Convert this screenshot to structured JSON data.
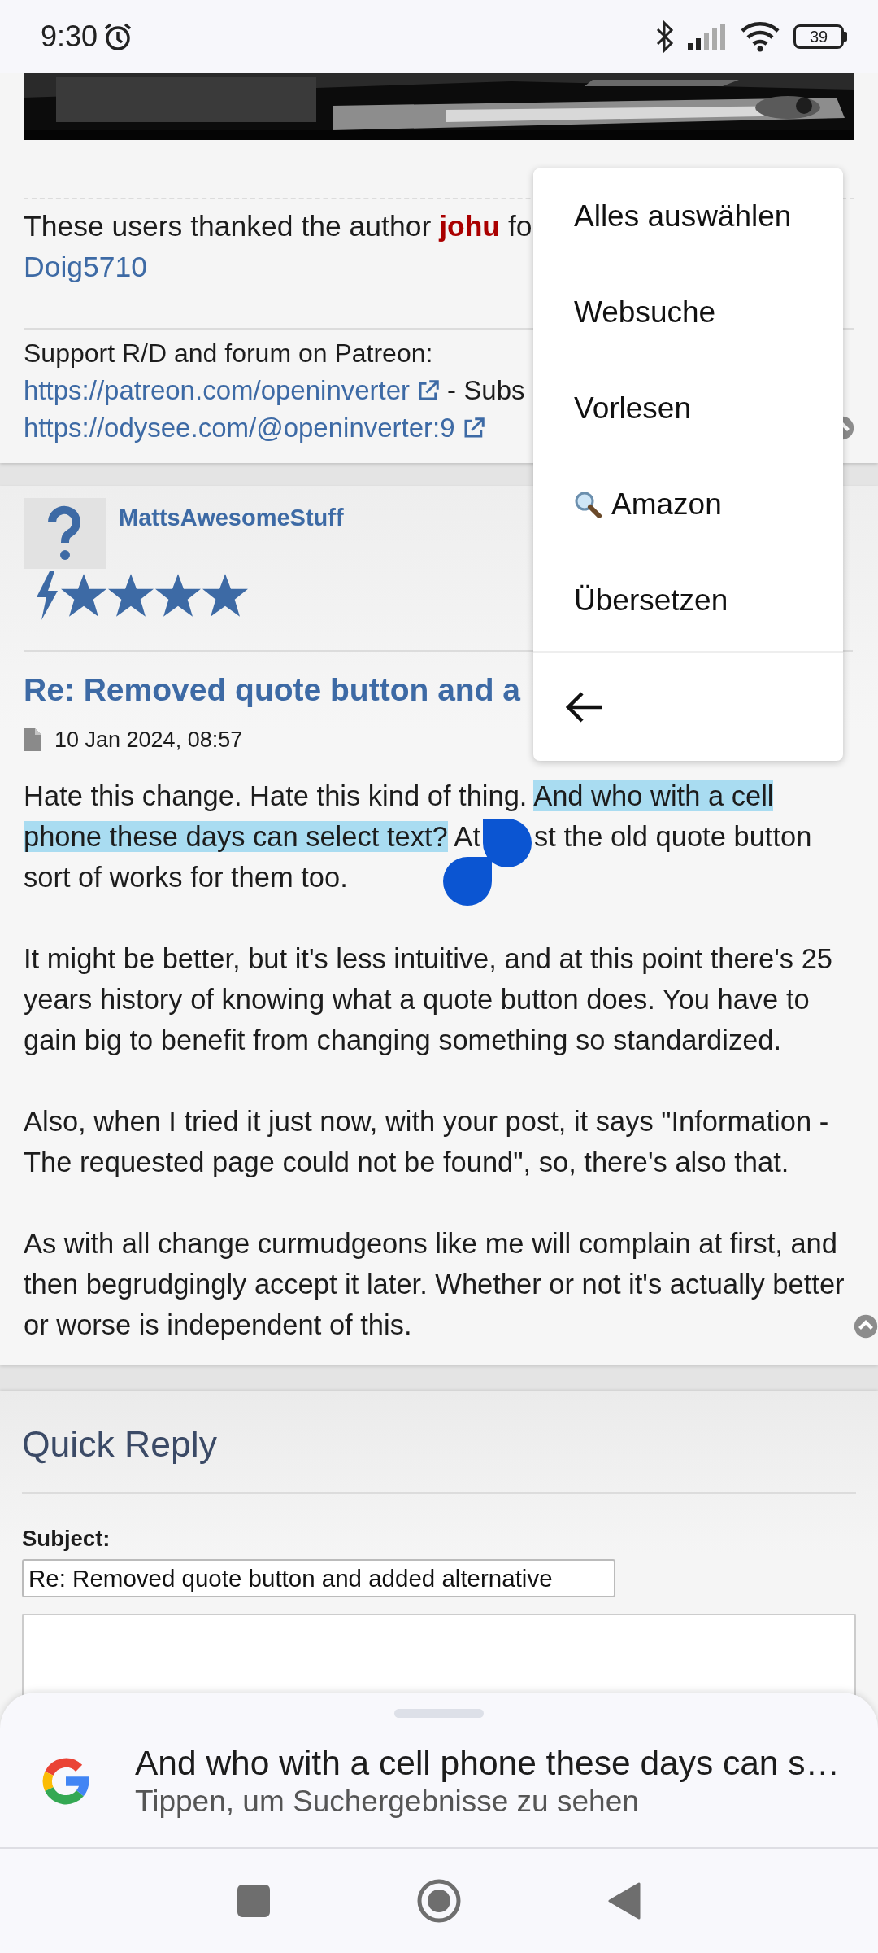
{
  "status_bar": {
    "time": "9:30",
    "battery": "39"
  },
  "previous_post": {
    "banner": {
      "kind": "picture"
    },
    "thanks": {
      "prefix": "These users thanked the author ",
      "author": "johu",
      "suffix": " fo"
    },
    "thanked_users": [
      "Doig5710"
    ],
    "signature": {
      "line": "Support R/D and forum on Patreon:",
      "links": [
        {
          "url": "https://patreon.com/openinverter",
          "after": " - Subs"
        },
        {
          "url": "https://odysee.com/@openinverter:9"
        }
      ]
    }
  },
  "post": {
    "author": "MattsAwesomeStuff",
    "stars": 4,
    "title": "Re: Removed quote button and a",
    "date": "10 Jan 2024, 08:57",
    "paragraphs": [
      {
        "segments": [
          {
            "kind": "text",
            "text": "Hate this change. Hate this kind of thing. ",
            "selected": false
          },
          {
            "kind": "text",
            "text": "And who with a cell phone these days can select text?",
            "selected": true
          },
          {
            "kind": "text",
            "text": " At",
            "selected": false
          },
          {
            "kind": "handles"
          },
          {
            "kind": "text",
            "text": "st the old quote button sort of works for them too.",
            "selected": false
          }
        ]
      },
      {
        "segments": [
          {
            "kind": "text",
            "text": "It might be better, but it's less intuitive, and at this point there's 25 years history of knowing what a quote button does. You have to gain big to benefit from changing something so standardized.",
            "selected": false
          }
        ]
      },
      {
        "segments": [
          {
            "kind": "text",
            "text": "Also, when I tried it just now, with your post, it says \"Information - The requested page could not be found\", so, there's also that.",
            "selected": false
          }
        ]
      },
      {
        "segments": [
          {
            "kind": "text",
            "text": "As with all change curmudgeons like me will complain at first, and then begrudgingly accept it later. Whether or not it's actually better or worse is independent of this.",
            "selected": false
          }
        ]
      }
    ]
  },
  "quick_reply": {
    "title": "Quick Reply",
    "subject_label": "Subject:",
    "subject_value": "Re: Removed quote button and added alternative"
  },
  "context_menu": {
    "items": [
      {
        "label": "Alles auswählen",
        "kind": "plain"
      },
      {
        "label": "Websuche",
        "kind": "plain"
      },
      {
        "label": "Vorlesen",
        "kind": "plain"
      },
      {
        "label": "Amazon",
        "kind": "search"
      },
      {
        "label": "Übersetzen",
        "kind": "plain"
      }
    ]
  },
  "search_sheet": {
    "title": "And who with a cell phone these days can s…",
    "subtitle": "Tippen, um Suchergebnisse zu sehen"
  }
}
